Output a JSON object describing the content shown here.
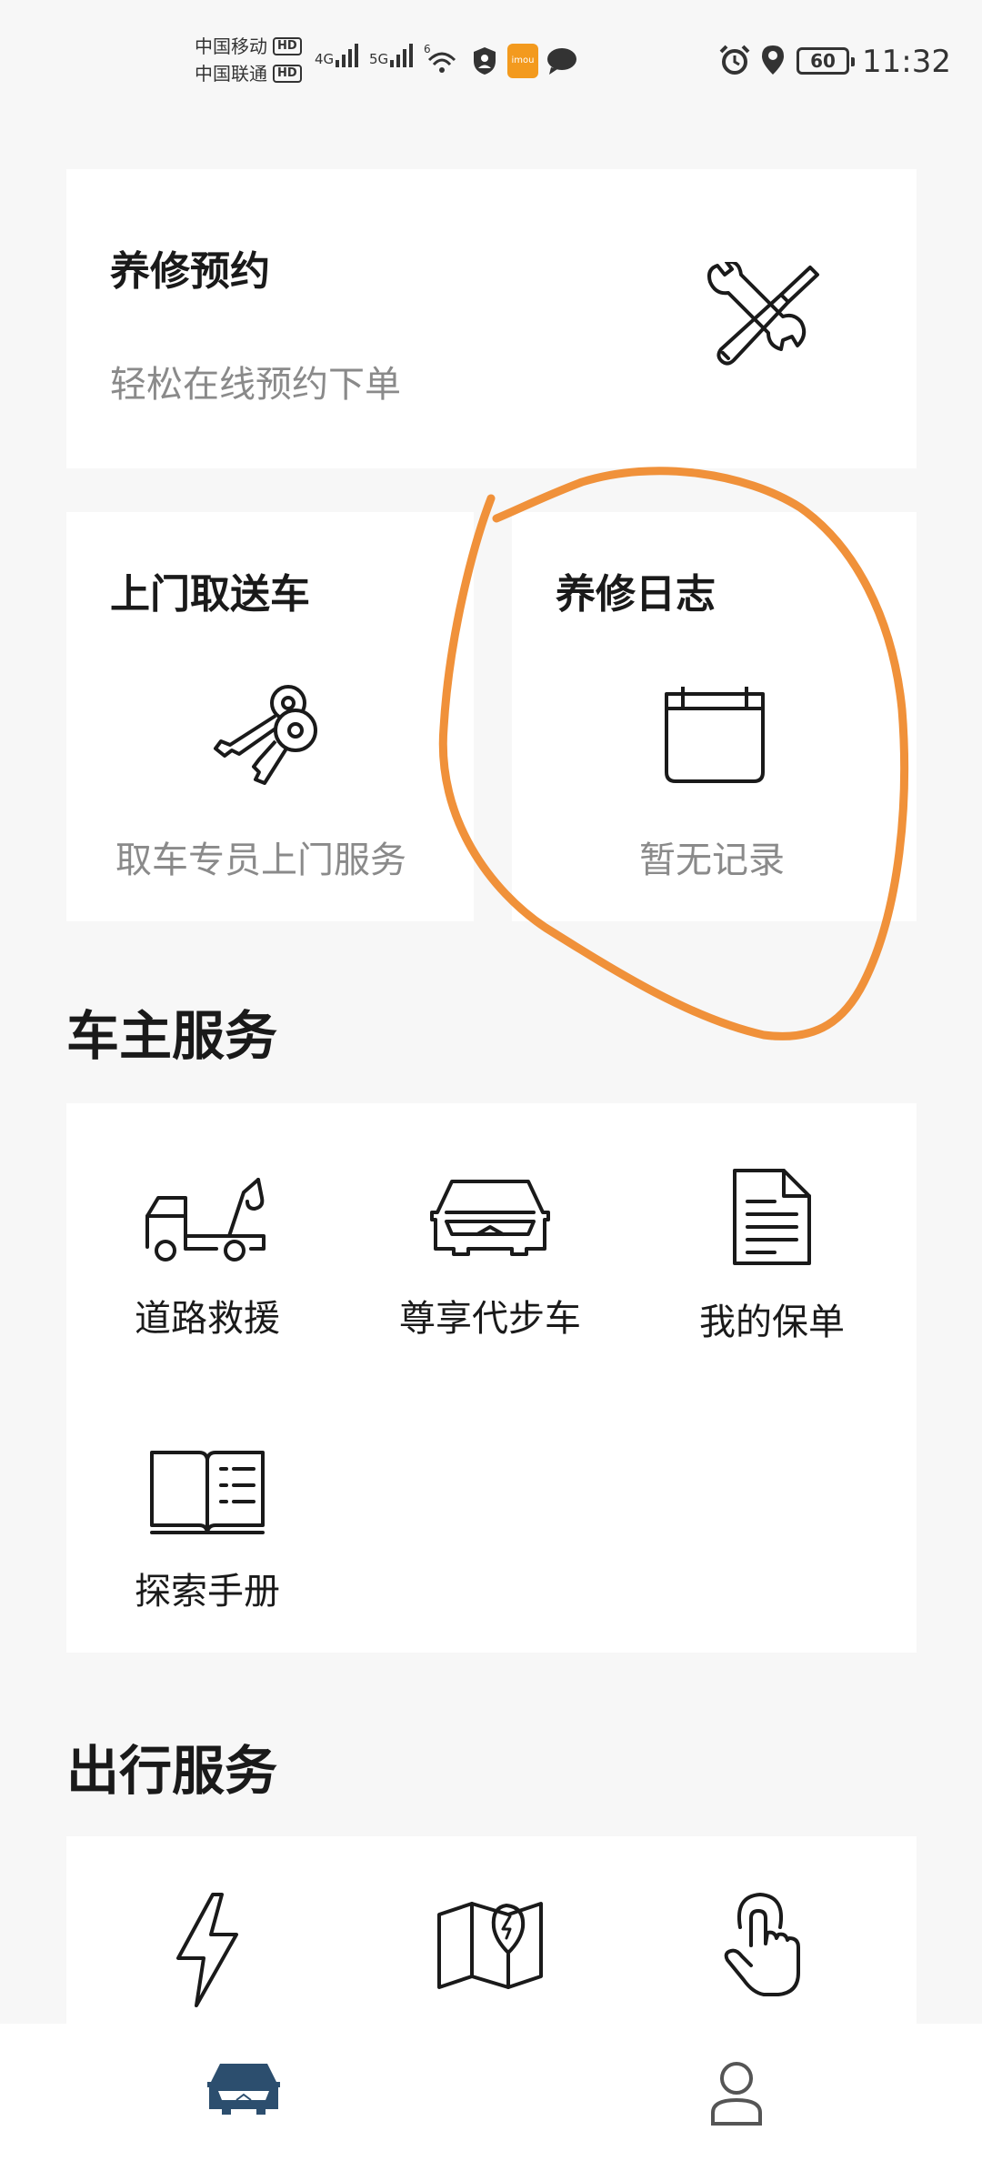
{
  "status_bar": {
    "carrier1": "中国移动",
    "carrier2": "中国联通",
    "hd": "HD",
    "net1": "4G",
    "net2": "5G",
    "wifi_tag": "6",
    "app_badge": "imou",
    "battery": "60",
    "time": "11:32"
  },
  "maintenance_booking": {
    "title": "养修预约",
    "subtitle": "轻松在线预约下单",
    "icon": "wrench-screwdriver-icon"
  },
  "pickup_delivery": {
    "title": "上门取送车",
    "subtitle": "取车专员上门服务",
    "icon": "keys-icon"
  },
  "maintenance_log": {
    "title": "养修日志",
    "subtitle": "暂无记录",
    "icon": "calendar-icon"
  },
  "owner_services": {
    "title": "车主服务",
    "items": [
      {
        "label": "道路救援",
        "icon": "tow-truck-icon"
      },
      {
        "label": "尊享代步车",
        "icon": "car-front-icon"
      },
      {
        "label": "我的保单",
        "icon": "document-icon"
      },
      {
        "label": "探索手册",
        "icon": "manual-book-icon"
      }
    ]
  },
  "travel_services": {
    "title": "出行服务",
    "items": [
      {
        "icon": "lightning-icon"
      },
      {
        "icon": "map-charging-icon"
      },
      {
        "icon": "tap-hand-icon"
      }
    ]
  },
  "bottom_nav": {
    "items": [
      {
        "icon": "car-icon",
        "active": true
      },
      {
        "icon": "profile-icon",
        "active": false
      }
    ]
  },
  "colors": {
    "annotation": "#f0913a",
    "active_nav": "#2c4e6e",
    "subtle_text": "#8a8a8a"
  }
}
